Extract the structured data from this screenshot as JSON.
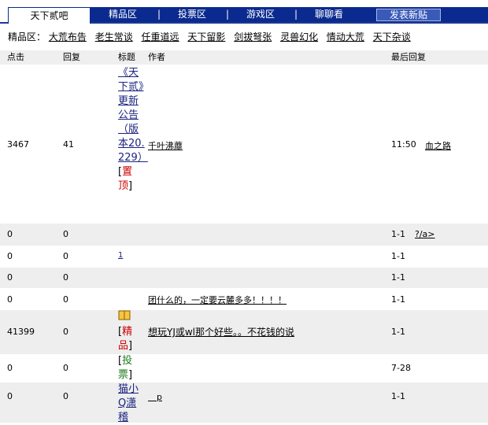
{
  "nav": {
    "active_tab": "天下贰吧",
    "tabs": [
      "精品区",
      "投票区",
      "游戏区",
      "聊聊看"
    ],
    "separator": "|",
    "post_button": "发表新贴"
  },
  "categories": {
    "label": "精品区：",
    "items": [
      "大荒布告",
      "老生常谈",
      "任重道远",
      "天下留影",
      "剑拔弩张",
      "灵兽幻化",
      "情动大荒",
      "天下杂谈"
    ]
  },
  "table": {
    "headers": {
      "clicks": "点击",
      "replies": "回复",
      "title": "标题",
      "author": "作者",
      "last_reply": "最后回复"
    },
    "rows": [
      {
        "clicks": "3467",
        "replies": "41",
        "title": "《天下贰》更新公告（版本20.229）",
        "tag": "置顶",
        "author": "千叶沸蘼",
        "time": "11:50",
        "last_user": "血之路"
      },
      {
        "clicks": "0",
        "replies": "0",
        "title": "",
        "tag": "",
        "author": "",
        "time": "1-1",
        "last_user": "?/a>"
      },
      {
        "clicks": "0",
        "replies": "0",
        "title": "1",
        "tag": "",
        "author": "",
        "time": "1-1",
        "last_user": ""
      },
      {
        "clicks": "0",
        "replies": "0",
        "title": "",
        "tag": "",
        "author": "",
        "time": "1-1",
        "last_user": ""
      },
      {
        "clicks": "0",
        "replies": "0",
        "title": "",
        "tag": "",
        "author": "团什么的，一定要云麓多多！！！！",
        "time": "1-1",
        "last_user": ""
      },
      {
        "clicks": "41399",
        "replies": "0",
        "title": "",
        "tag": "精品",
        "author": "想玩YJ或wl那个好些。。不花钱的说",
        "time": "1-1",
        "last_user": ""
      },
      {
        "clicks": "0",
        "replies": "0",
        "title": "",
        "tag": "投票",
        "author": "",
        "time": "7-28",
        "last_user": ""
      },
      {
        "clicks": "0",
        "replies": "0",
        "title": "猫小Q潇稽",
        "tag": "",
        "author": "　p",
        "time": "1-1",
        "last_user": ""
      }
    ]
  },
  "colors": {
    "nav_bg": "#0b2a8f",
    "tag_red": "#cc0000",
    "tag_green": "#1a7a1a",
    "link": "#1a237e"
  }
}
